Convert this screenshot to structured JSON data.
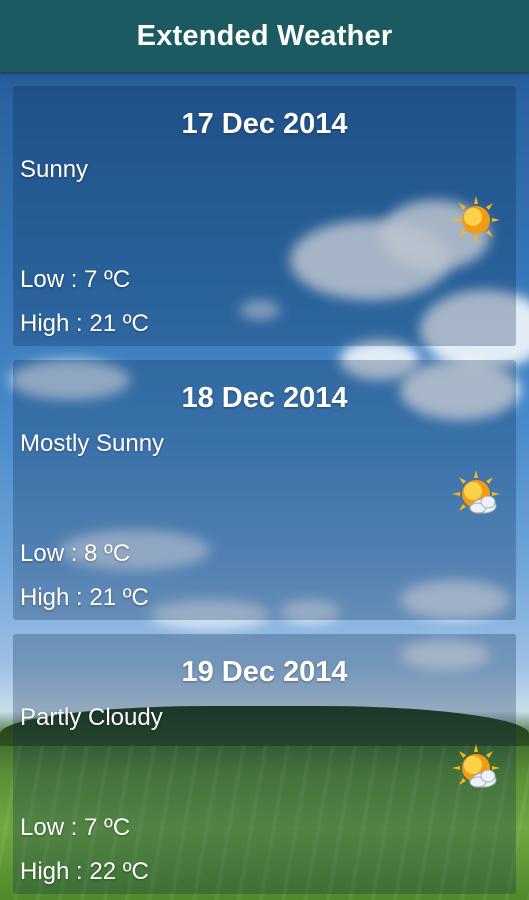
{
  "header": {
    "title": "Extended Weather"
  },
  "forecast": [
    {
      "date": "17 Dec 2014",
      "condition": "Sunny",
      "low": "Low  : 7 ºC",
      "high": "High : 21 ºC",
      "icon": "sun-icon"
    },
    {
      "date": "18 Dec 2014",
      "condition": "Mostly Sunny",
      "low": "Low  : 8 ºC",
      "high": "High : 21 ºC",
      "icon": "sun-cloud-icon"
    },
    {
      "date": "19 Dec 2014",
      "condition": "Partly Cloudy",
      "low": "Low  : 7 ºC",
      "high": "High : 22 ºC",
      "icon": "sun-cloud-icon"
    }
  ],
  "colors": {
    "header_bg": "#1c5a62",
    "text": "#ffffff",
    "sun": "#f6b81b"
  }
}
